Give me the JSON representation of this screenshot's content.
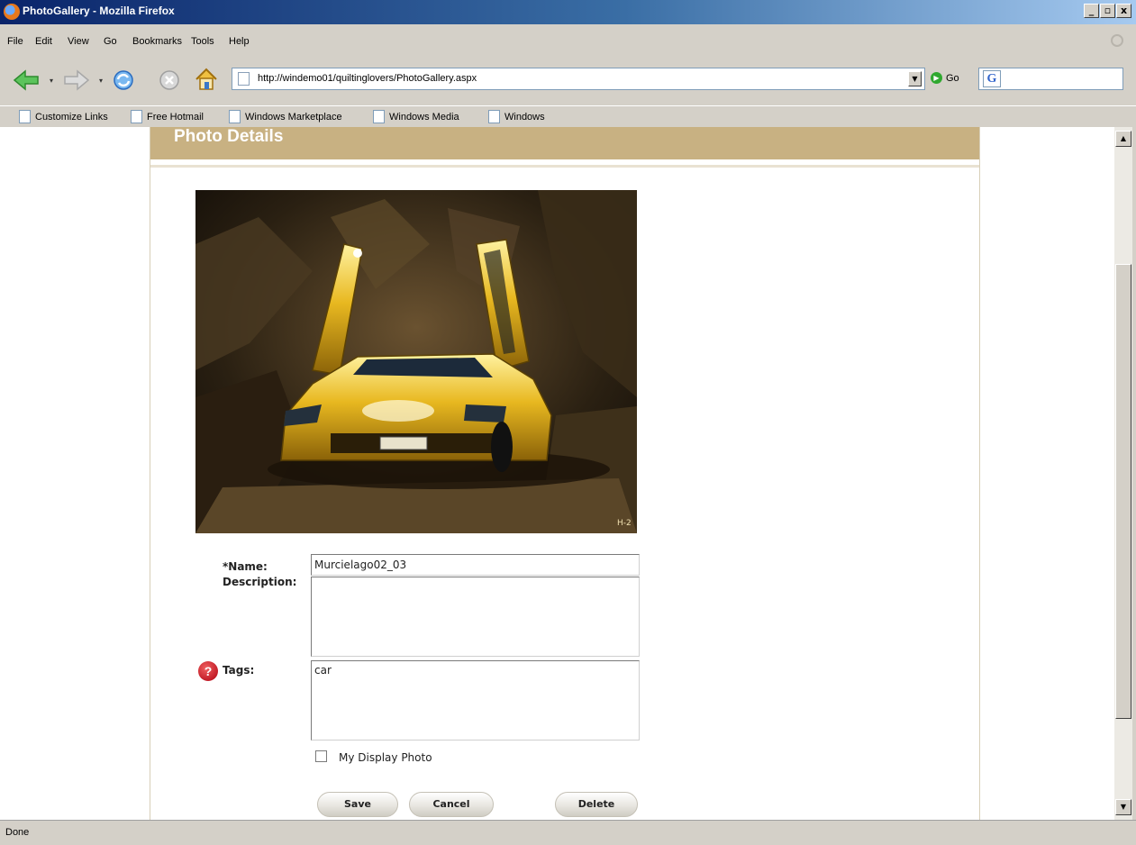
{
  "window": {
    "title": "PhotoGallery - Mozilla Firefox",
    "min": "_",
    "max": "▫",
    "close": "x"
  },
  "menu": {
    "file": "File",
    "edit": "Edit",
    "view": "View",
    "go": "Go",
    "bookmarks": "Bookmarks",
    "tools": "Tools",
    "help": "Help"
  },
  "nav": {
    "url": "http://windemo01/quiltinglovers/PhotoGallery.aspx",
    "go_label": "Go",
    "search_engine": "G"
  },
  "bookmarks": [
    "Customize Links",
    "Free Hotmail",
    "Windows Marketplace",
    "Windows Media",
    "Windows"
  ],
  "page": {
    "panel_title": "Photo Details",
    "form": {
      "name_label": "*Name:",
      "name_value": "Murcielago02_03",
      "description_label": "Description:",
      "description_value": "",
      "tags_label": "Tags:",
      "tags_value": "car",
      "display_photo_label": "My Display Photo",
      "display_photo_checked": false,
      "save": "Save",
      "cancel": "Cancel",
      "delete": "Delete"
    },
    "photo_watermark": "H-2"
  },
  "status": {
    "text": "Done"
  },
  "colors": {
    "panel_header": "#c8b182",
    "title_bar": "#0a246a",
    "help_icon": "#c0101e"
  }
}
